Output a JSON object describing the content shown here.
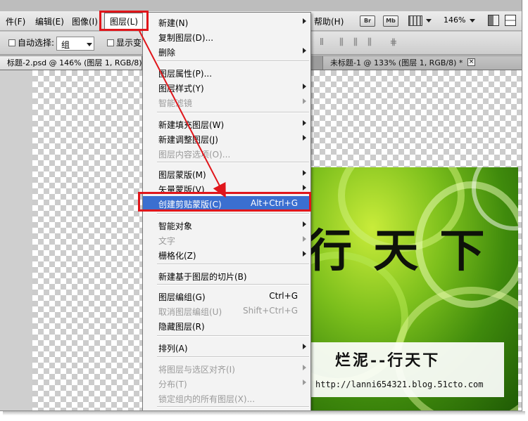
{
  "menubar": {
    "items": [
      "件(F)",
      "编辑(E)",
      "图像(I)",
      "图层(L)",
      "帮助(H)"
    ],
    "bridge_labels": [
      "Br",
      "Mb"
    ],
    "zoom": "146%"
  },
  "options": {
    "auto_select_label": "自动选择:",
    "auto_select_value": "组",
    "show_transform_label": "显示变"
  },
  "tabs": {
    "left": "标题-2.psd @ 146% (图层 1, RGB/8)",
    "right": "未标题-1 @ 133% (图层 1, RGB/8) *",
    "close_glyph": "×"
  },
  "menu": {
    "items": [
      {
        "label": "新建(N)",
        "submenu": true
      },
      {
        "label": "复制图层(D)..."
      },
      {
        "label": "删除",
        "submenu": true
      },
      {
        "label": "图层属性(P)..."
      },
      {
        "label": "图层样式(Y)",
        "submenu": true
      },
      {
        "label": "智能滤镜",
        "submenu": true,
        "disabled": true
      },
      {
        "label": "新建填充图层(W)",
        "submenu": true
      },
      {
        "label": "新建调整图层(J)",
        "submenu": true
      },
      {
        "label": "图层内容选项(O)...",
        "disabled": true
      },
      {
        "label": "图层蒙版(M)",
        "submenu": true
      },
      {
        "label": "矢量蒙版(V)",
        "submenu": true
      },
      {
        "label": "创建剪贴蒙版(C)",
        "shortcut": "Alt+Ctrl+G",
        "highlighted": true
      },
      {
        "label": "智能对象",
        "submenu": true
      },
      {
        "label": "文字",
        "submenu": true,
        "disabled": true
      },
      {
        "label": "栅格化(Z)",
        "submenu": true
      },
      {
        "label": "新建基于图层的切片(B)"
      },
      {
        "label": "图层编组(G)",
        "shortcut": "Ctrl+G"
      },
      {
        "label": "取消图层编组(U)",
        "shortcut": "Shift+Ctrl+G",
        "disabled": true
      },
      {
        "label": "隐藏图层(R)"
      },
      {
        "label": "排列(A)",
        "submenu": true
      },
      {
        "label": "将图层与选区对齐(I)",
        "submenu": true,
        "disabled": true
      },
      {
        "label": "分布(T)",
        "submenu": true,
        "disabled": true
      },
      {
        "label": "锁定组内的所有图层(X)...",
        "disabled": true
      }
    ]
  },
  "canvas": {
    "art_text": "行 天 下",
    "watermark_title": "烂泥--行天下",
    "watermark_url": "http://lanni654321.blog.51cto.com"
  },
  "colors": {
    "highlight": "#3b6fd0",
    "annotation_red": "#e0161b"
  }
}
